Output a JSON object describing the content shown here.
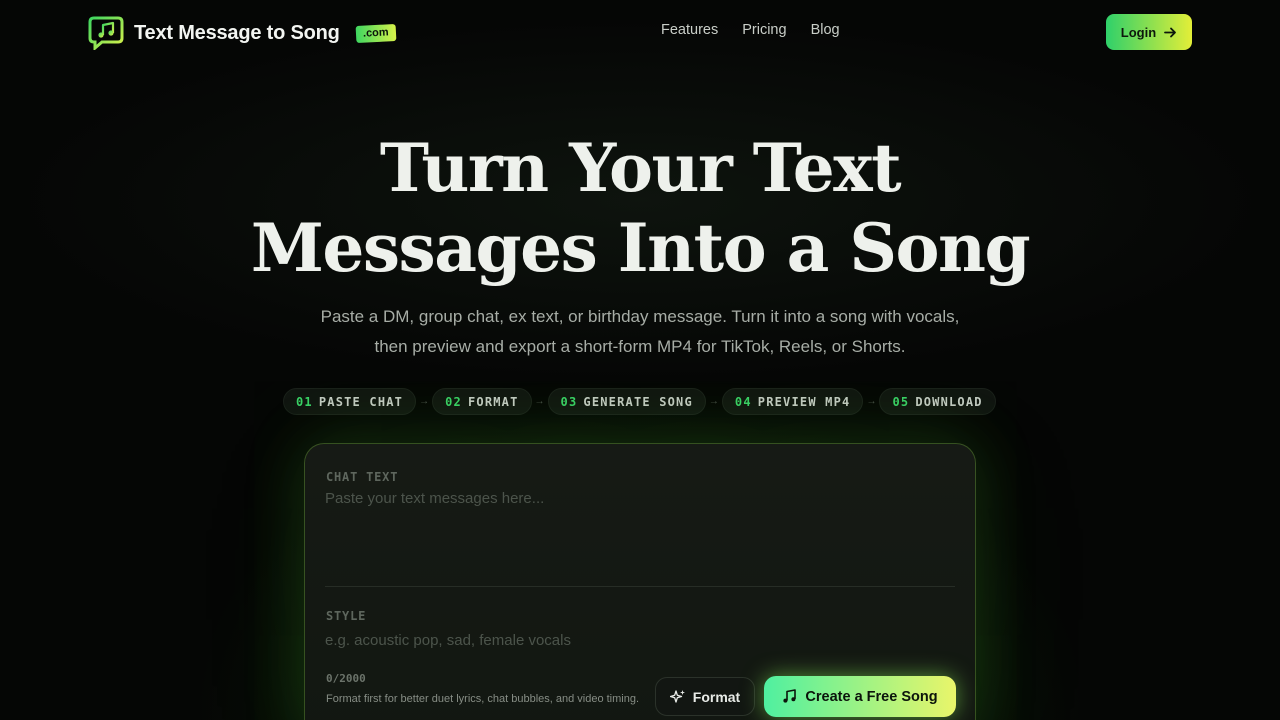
{
  "header": {
    "brand_name": "Text Message to Song",
    "brand_tld": ".com",
    "nav": [
      "Features",
      "Pricing",
      "Blog"
    ],
    "login_label": "Login"
  },
  "hero": {
    "title_line1": "Turn Your Text",
    "title_line2": "Messages Into a Song",
    "subtitle": "Paste a DM, group chat, ex text, or birthday message. Turn it into a song with vocals, then preview and export a short-form MP4 for TikTok, Reels, or Shorts."
  },
  "steps": [
    {
      "num": "01",
      "label": "PASTE CHAT"
    },
    {
      "num": "02",
      "label": "FORMAT"
    },
    {
      "num": "03",
      "label": "GENERATE SONG"
    },
    {
      "num": "04",
      "label": "PREVIEW MP4"
    },
    {
      "num": "05",
      "label": "DOWNLOAD"
    }
  ],
  "form": {
    "chat_label": "CHAT TEXT",
    "chat_placeholder": "Paste your text messages here...",
    "chat_value": "",
    "style_label": "STYLE",
    "style_placeholder": "e.g. acoustic pop, sad, female vocals",
    "style_value": "",
    "counter": "0/2000",
    "hint": "Format first for better duet lyrics, chat bubbles, and video timing.",
    "format_label": "Format",
    "create_label": "Create a Free Song"
  },
  "colors": {
    "accent_green": "#3ad267",
    "accent_lime": "#e3ee38",
    "background": "#050605"
  },
  "icons": {
    "logo": "chat-bubble-music-icon",
    "login": "arrow-right-icon",
    "format": "sparkles-icon",
    "create": "music-note-icon"
  }
}
